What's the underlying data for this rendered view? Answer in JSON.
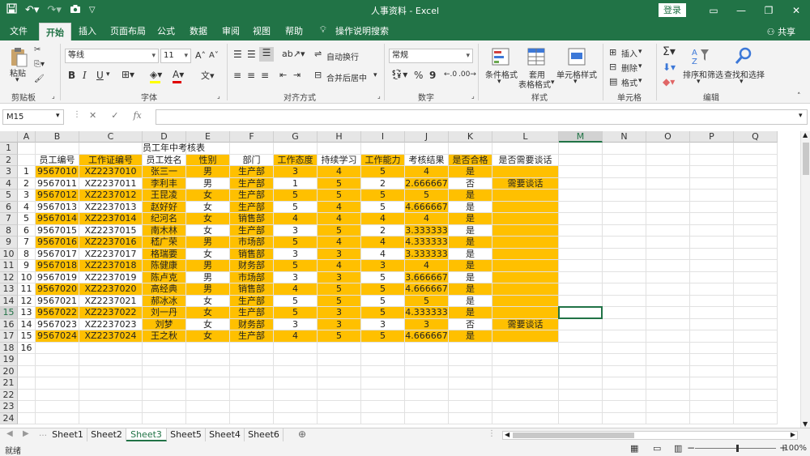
{
  "titlebar": {
    "title": "人事资料 - Excel",
    "login": "登录",
    "qat_icons": [
      "save-icon",
      "undo-icon",
      "redo-icon",
      "camera-icon",
      "customize-icon"
    ]
  },
  "tabs": [
    "文件",
    "开始",
    "插入",
    "页面布局",
    "公式",
    "数据",
    "审阅",
    "视图",
    "帮助"
  ],
  "active_tab": "开始",
  "tell_me": "操作说明搜索",
  "share": "共享",
  "ribbon": {
    "clipboard": {
      "paste": "粘贴",
      "label": "剪贴板"
    },
    "font": {
      "name": "等线",
      "size": "11",
      "label": "字体",
      "bold": "B",
      "italic": "I",
      "underline": "U"
    },
    "alignment": {
      "wrap": "自动换行",
      "merge": "合并后居中",
      "label": "对齐方式"
    },
    "number": {
      "format": "常规",
      "percent": "%",
      "comma": "9",
      "label": "数字"
    },
    "styles": {
      "conditional": "条件格式",
      "table1": "套用",
      "table2": "表格格式",
      "cell_styles": "单元格样式",
      "label": "样式"
    },
    "cells": {
      "insert": "插入",
      "delete": "删除",
      "format": "格式",
      "label": "单元格"
    },
    "editing": {
      "sort": "排序和筛选",
      "find": "查找和选择",
      "label": "编辑"
    }
  },
  "formula_bar": {
    "name_box": "M15",
    "fx": "fx",
    "value": ""
  },
  "grid": {
    "columns": [
      "A",
      "B",
      "C",
      "D",
      "E",
      "F",
      "G",
      "H",
      "I",
      "J",
      "K",
      "L",
      "M",
      "N",
      "O",
      "P",
      "Q"
    ],
    "selected_column": "M",
    "selected_row": 15,
    "title": "员工年中考核表",
    "headers": [
      "员工编号",
      "工作证编号",
      "员工姓名",
      "性别",
      "部门",
      "工作态度",
      "持续学习",
      "工作能力",
      "考核结果",
      "是否合格",
      "是否需要谈话"
    ],
    "rows": [
      {
        "a": "1",
        "b": "9567010",
        "c": "XZ2237010",
        "d": "张三一",
        "e": "男",
        "f": "生产部",
        "g": "3",
        "h": "4",
        "i": "5",
        "j": "4",
        "k": "是",
        "l": ""
      },
      {
        "a": "2",
        "b": "9567011",
        "c": "XZ2237011",
        "d": "李利丰",
        "e": "男",
        "f": "生产部",
        "g": "1",
        "h": "5",
        "i": "2",
        "j": "2.666667",
        "k": "否",
        "l": "需要谈话"
      },
      {
        "a": "3",
        "b": "9567012",
        "c": "XZ2237012",
        "d": "王昆凌",
        "e": "女",
        "f": "生产部",
        "g": "5",
        "h": "5",
        "i": "5",
        "j": "5",
        "k": "是",
        "l": ""
      },
      {
        "a": "4",
        "b": "9567013",
        "c": "XZ2237013",
        "d": "赵好好",
        "e": "女",
        "f": "生产部",
        "g": "5",
        "h": "4",
        "i": "5",
        "j": "4.666667",
        "k": "是",
        "l": ""
      },
      {
        "a": "5",
        "b": "9567014",
        "c": "XZ2237014",
        "d": "纪河名",
        "e": "女",
        "f": "销售部",
        "g": "4",
        "h": "4",
        "i": "4",
        "j": "4",
        "k": "是",
        "l": ""
      },
      {
        "a": "6",
        "b": "9567015",
        "c": "XZ2237015",
        "d": "南木林",
        "e": "女",
        "f": "生产部",
        "g": "3",
        "h": "5",
        "i": "2",
        "j": "3.333333",
        "k": "是",
        "l": ""
      },
      {
        "a": "7",
        "b": "9567016",
        "c": "XZ2237016",
        "d": "嵇广荣",
        "e": "男",
        "f": "市场部",
        "g": "5",
        "h": "4",
        "i": "4",
        "j": "4.333333",
        "k": "是",
        "l": ""
      },
      {
        "a": "8",
        "b": "9567017",
        "c": "XZ2237017",
        "d": "格瑞要",
        "e": "女",
        "f": "销售部",
        "g": "3",
        "h": "3",
        "i": "4",
        "j": "3.333333",
        "k": "是",
        "l": ""
      },
      {
        "a": "9",
        "b": "9567018",
        "c": "XZ2237018",
        "d": "陈健康",
        "e": "男",
        "f": "财务部",
        "g": "5",
        "h": "4",
        "i": "3",
        "j": "4",
        "k": "是",
        "l": ""
      },
      {
        "a": "10",
        "b": "9567019",
        "c": "XZ2237019",
        "d": "陈卢克",
        "e": "男",
        "f": "市场部",
        "g": "3",
        "h": "3",
        "i": "5",
        "j": "3.666667",
        "k": "是",
        "l": ""
      },
      {
        "a": "11",
        "b": "9567020",
        "c": "XZ2237020",
        "d": "高经典",
        "e": "男",
        "f": "销售部",
        "g": "4",
        "h": "5",
        "i": "5",
        "j": "4.666667",
        "k": "是",
        "l": ""
      },
      {
        "a": "12",
        "b": "9567021",
        "c": "XZ2237021",
        "d": "郝冰冰",
        "e": "女",
        "f": "生产部",
        "g": "5",
        "h": "5",
        "i": "5",
        "j": "5",
        "k": "是",
        "l": ""
      },
      {
        "a": "13",
        "b": "9567022",
        "c": "XZ2237022",
        "d": "刘一丹",
        "e": "女",
        "f": "生产部",
        "g": "5",
        "h": "3",
        "i": "5",
        "j": "4.333333",
        "k": "是",
        "l": ""
      },
      {
        "a": "14",
        "b": "9567023",
        "c": "XZ2237023",
        "d": "刘梦",
        "e": "女",
        "f": "财务部",
        "g": "3",
        "h": "3",
        "i": "3",
        "j": "3",
        "k": "否",
        "l": "需要谈话"
      },
      {
        "a": "15",
        "b": "9567024",
        "c": "XZ2237024",
        "d": "王之秋",
        "e": "女",
        "f": "生产部",
        "g": "4",
        "h": "5",
        "i": "5",
        "j": "4.666667",
        "k": "是",
        "l": ""
      },
      {
        "a": "16",
        "b": "",
        "c": "",
        "d": "",
        "e": "",
        "f": "",
        "g": "",
        "h": "",
        "i": "",
        "j": "",
        "k": "",
        "l": ""
      }
    ],
    "visible_rows": 24
  },
  "sheets": [
    "Sheet1",
    "Sheet2",
    "Sheet3",
    "Sheet5",
    "Sheet4",
    "Sheet6"
  ],
  "active_sheet": "Sheet3",
  "status": {
    "ready": "就绪",
    "zoom": "100%"
  },
  "colors": {
    "accent": "#217346",
    "highlight": "#ffc000"
  }
}
